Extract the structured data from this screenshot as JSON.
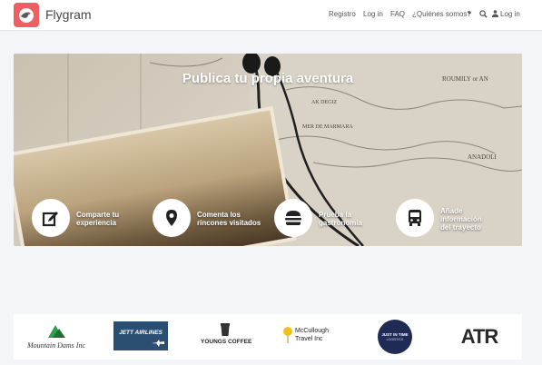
{
  "navbar": {
    "brand": "Flygram",
    "links": [
      "Registro",
      "Log in",
      "FAQ",
      "¿Quiénes somos?"
    ],
    "user_login": "Log in",
    "icons": {
      "logo": "bird-logo-icon",
      "search": "search-icon",
      "user": "user-icon",
      "caret": "chevron-down-icon"
    }
  },
  "hero": {
    "title": "Publica tu propia aventura",
    "features": [
      {
        "icon": "edit-icon",
        "line1": "Comparte tu",
        "line2": "experiencia",
        "line3": ""
      },
      {
        "icon": "map-pin-icon",
        "line1": "Comenta los",
        "line2": "rincones visitados",
        "line3": ""
      },
      {
        "icon": "burger-icon",
        "line1": "Prueba la",
        "line2": "gastronomía",
        "line3": ""
      },
      {
        "icon": "bus-icon",
        "line1": "Añade",
        "line2": "información",
        "line3": "del trayecto"
      }
    ]
  },
  "map_text": {
    "roumily": "ROUMILY or AN",
    "ak_degiz": "AK DEGIZ",
    "mer_de_marmara": "MER DE MARMARA",
    "anadoli": "ANADOLI"
  },
  "partners": [
    {
      "name": "Mountain Dams Inc",
      "line1": "Mountain Dams Inc",
      "line2": ""
    },
    {
      "name": "Jett Airlines",
      "line1": "JETT AIRLINES",
      "line2": ""
    },
    {
      "name": "Youngs Coffee",
      "line1": "YOUNGS COFFEE",
      "line2": ""
    },
    {
      "name": "McCullough Travel Inc",
      "line1": "McCullough",
      "line2": "Travel Inc"
    },
    {
      "name": "Just In Time Logistics",
      "line1": "JUST IN TIME",
      "line2": "LOGISTICS"
    },
    {
      "name": "ATR",
      "line1": "ATR",
      "line2": ""
    }
  ],
  "colors": {
    "brand": "#ee5f63",
    "background": "#f4f5f8",
    "jett_blue": "#2b4f72",
    "jit_navy": "#1f2a55",
    "mountain_green": "#2e9e4a"
  }
}
